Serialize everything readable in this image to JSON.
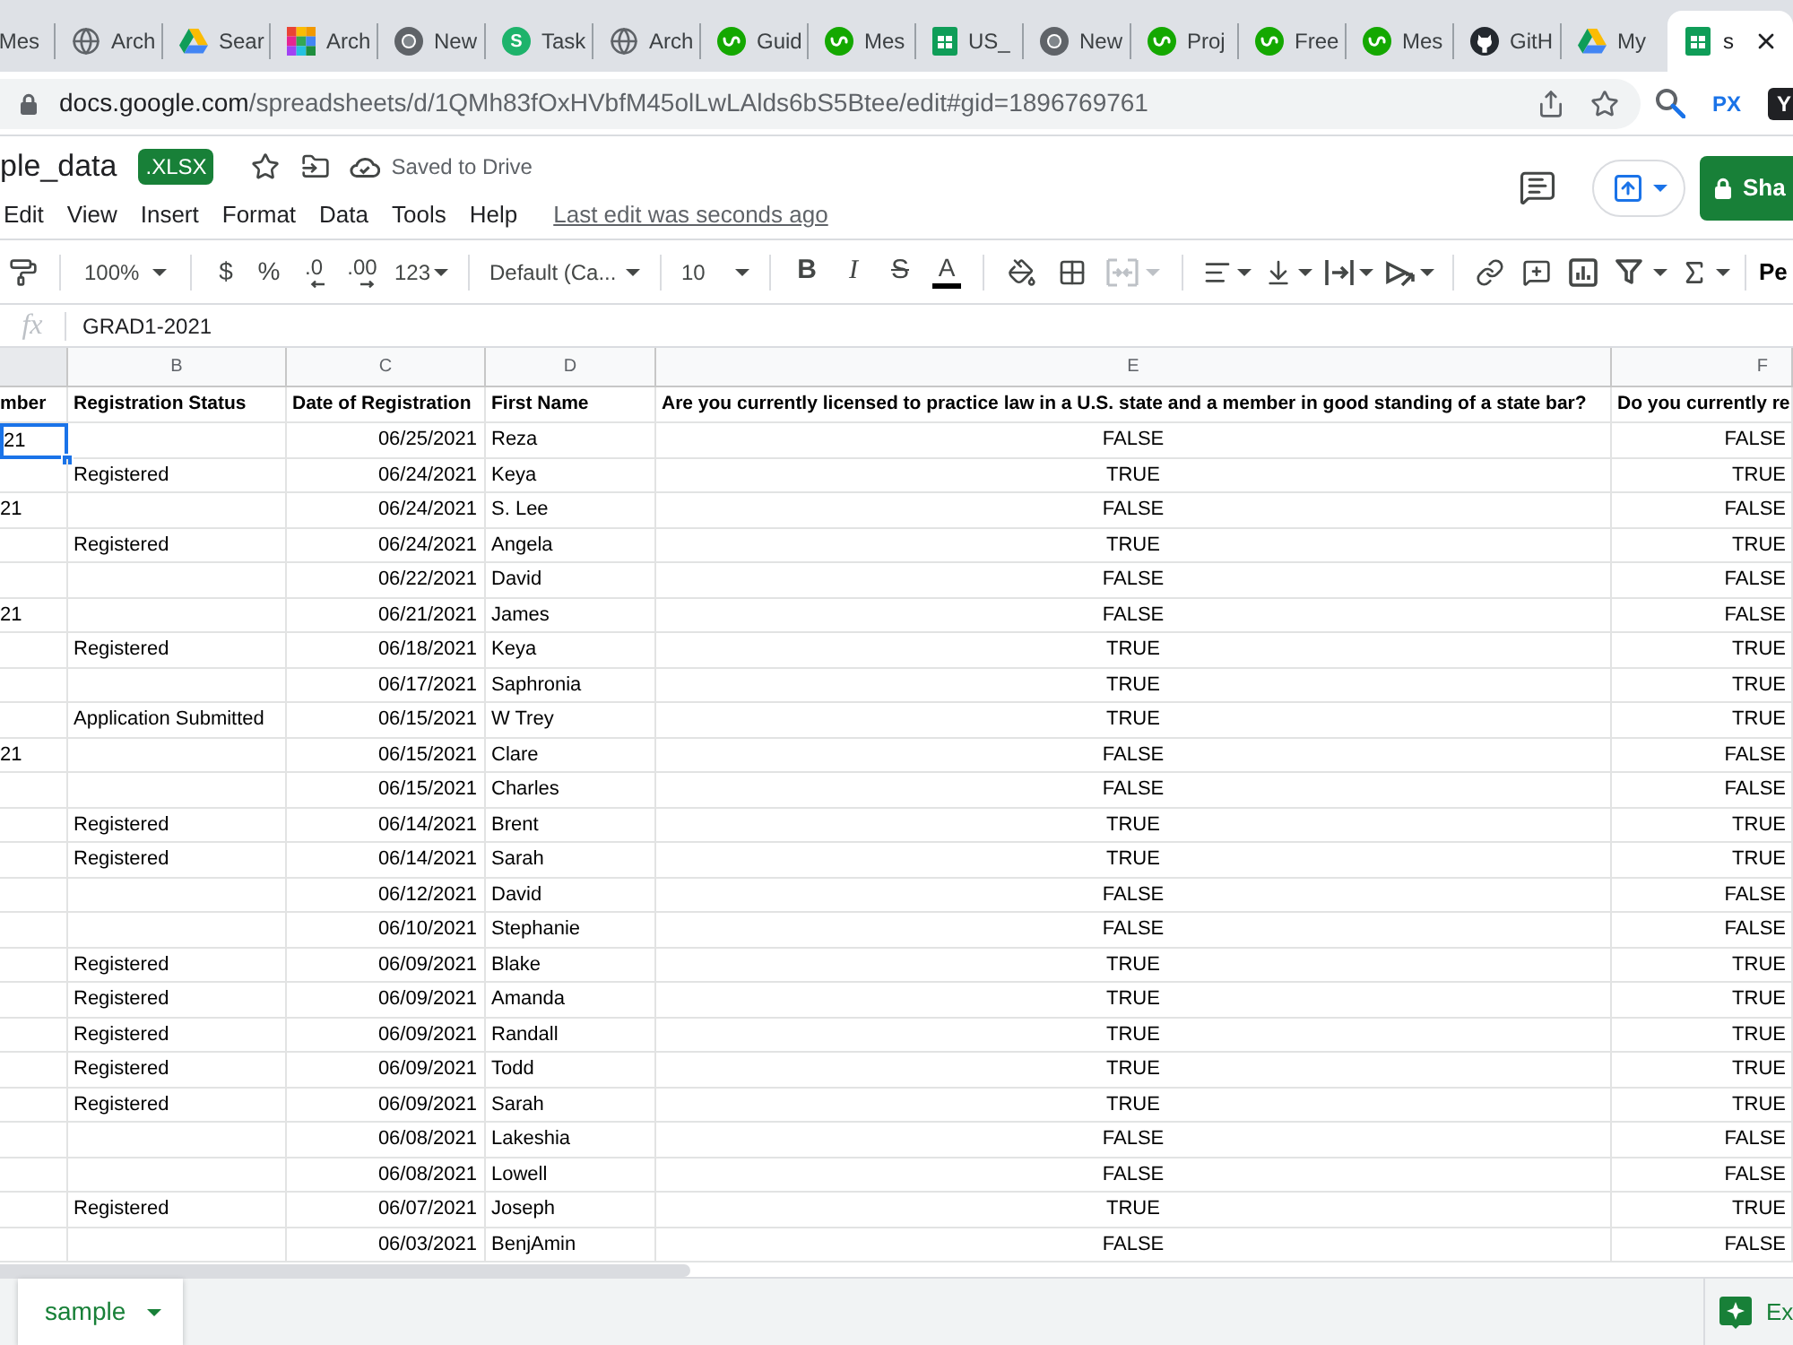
{
  "browser": {
    "tabs": [
      {
        "label": "Mes",
        "kind": "text_only",
        "selected": false
      },
      {
        "label": "Arch",
        "kind": "globe",
        "selected": false
      },
      {
        "label": "Sear",
        "kind": "drive",
        "selected": false
      },
      {
        "label": "Arch",
        "kind": "grid",
        "selected": false
      },
      {
        "label": "New",
        "kind": "chrome",
        "selected": false
      },
      {
        "label": "Task",
        "kind": "letter",
        "icon_text": "S",
        "selected": false
      },
      {
        "label": "Arch",
        "kind": "globe",
        "selected": false
      },
      {
        "label": "Guid",
        "kind": "upwork",
        "selected": false
      },
      {
        "label": "Mes",
        "kind": "upwork",
        "selected": false
      },
      {
        "label": "US_",
        "kind": "sheets",
        "selected": false
      },
      {
        "label": "New",
        "kind": "chrome",
        "selected": false
      },
      {
        "label": "Proj",
        "kind": "upwork",
        "selected": false
      },
      {
        "label": "Free",
        "kind": "upwork",
        "selected": false
      },
      {
        "label": "Mes",
        "kind": "upwork",
        "selected": false
      },
      {
        "label": "GitH",
        "kind": "github",
        "selected": false
      },
      {
        "label": "My",
        "kind": "drive",
        "selected": false
      },
      {
        "label": "s",
        "kind": "sheets",
        "selected": true
      }
    ],
    "address": {
      "host": "docs.google.com",
      "path": "/spreadsheets/d/1QMh83fOxHVbfM45olLwLAlds6bS5Btee/edit#gid=1896769761"
    },
    "extensions": [
      {
        "kind": "magnifier"
      },
      {
        "kind": "text",
        "text": "PX"
      },
      {
        "kind": "tile",
        "text": "Y"
      }
    ]
  },
  "doc": {
    "title": "ple_data",
    "badge": ".XLSX",
    "save_status": "Saved to Drive",
    "share": "Sha"
  },
  "menu": [
    "Edit",
    "View",
    "Insert",
    "Format",
    "Data",
    "Tools",
    "Help"
  ],
  "last_edit": "Last edit was seconds ago",
  "toolbar": {
    "zoom": "100%",
    "currency": "$",
    "percent": "%",
    "decimal_less": ".0",
    "decimal_more": ".00",
    "number_format": "123",
    "font": "Default (Ca...",
    "font_size": "10",
    "bold": "B",
    "italic": "I",
    "strike": "S",
    "text_color": "A",
    "merge_disabled": true,
    "overflow": "Pe"
  },
  "formula_bar": {
    "label": "fx",
    "value": "GRAD1-2021"
  },
  "columns": [
    {
      "header": "mber",
      "selected": true
    },
    {
      "letter": "B",
      "header": "Registration Status",
      "selected": false
    },
    {
      "letter": "C",
      "header": "Date of Registration",
      "selected": false
    },
    {
      "letter": "D",
      "header": "First Name",
      "selected": false
    },
    {
      "letter": "E",
      "header": "Are you currently licensed to practice law in a U.S. state and a member in good standing of a state bar?",
      "selected": false
    },
    {
      "letter": "F",
      "header": "Do you currently re",
      "selected": false
    }
  ],
  "rows": [
    {
      "cells": [
        "21",
        null,
        "06/25/2021",
        "Reza",
        "FALSE",
        "FALSE"
      ],
      "active": true
    },
    {
      "cells": [
        null,
        "Registered",
        "06/24/2021",
        "Keya",
        "TRUE",
        "TRUE"
      ],
      "active": false
    },
    {
      "cells": [
        "21",
        null,
        "06/24/2021",
        "S. Lee",
        "FALSE",
        "FALSE"
      ],
      "active": false
    },
    {
      "cells": [
        null,
        "Registered",
        "06/24/2021",
        "Angela",
        "TRUE",
        "TRUE"
      ],
      "active": false
    },
    {
      "cells": [
        null,
        null,
        "06/22/2021",
        "David",
        "FALSE",
        "FALSE"
      ],
      "active": false
    },
    {
      "cells": [
        "21",
        null,
        "06/21/2021",
        "James",
        "FALSE",
        "FALSE"
      ],
      "active": false
    },
    {
      "cells": [
        null,
        "Registered",
        "06/18/2021",
        "Keya",
        "TRUE",
        "TRUE"
      ],
      "active": false
    },
    {
      "cells": [
        null,
        null,
        "06/17/2021",
        "Saphronia",
        "TRUE",
        "TRUE"
      ],
      "active": false
    },
    {
      "cells": [
        null,
        "Application Submitted",
        "06/15/2021",
        "W Trey",
        "TRUE",
        "TRUE"
      ],
      "active": false
    },
    {
      "cells": [
        "21",
        null,
        "06/15/2021",
        "Clare",
        "FALSE",
        "FALSE"
      ],
      "active": false
    },
    {
      "cells": [
        null,
        null,
        "06/15/2021",
        "Charles",
        "FALSE",
        "FALSE"
      ],
      "active": false
    },
    {
      "cells": [
        null,
        "Registered",
        "06/14/2021",
        "Brent",
        "TRUE",
        "TRUE"
      ],
      "active": false
    },
    {
      "cells": [
        null,
        "Registered",
        "06/14/2021",
        "Sarah",
        "TRUE",
        "TRUE"
      ],
      "active": false
    },
    {
      "cells": [
        null,
        null,
        "06/12/2021",
        "David",
        "FALSE",
        "FALSE"
      ],
      "active": false
    },
    {
      "cells": [
        null,
        null,
        "06/10/2021",
        "Stephanie",
        "FALSE",
        "FALSE"
      ],
      "active": false
    },
    {
      "cells": [
        null,
        "Registered",
        "06/09/2021",
        "Blake",
        "TRUE",
        "TRUE"
      ],
      "active": false
    },
    {
      "cells": [
        null,
        "Registered",
        "06/09/2021",
        "Amanda",
        "TRUE",
        "TRUE"
      ],
      "active": false
    },
    {
      "cells": [
        null,
        "Registered",
        "06/09/2021",
        "Randall",
        "TRUE",
        "TRUE"
      ],
      "active": false
    },
    {
      "cells": [
        null,
        "Registered",
        "06/09/2021",
        "Todd",
        "TRUE",
        "TRUE"
      ],
      "active": false
    },
    {
      "cells": [
        null,
        "Registered",
        "06/09/2021",
        "Sarah",
        "TRUE",
        "TRUE"
      ],
      "active": false
    },
    {
      "cells": [
        null,
        null,
        "06/08/2021",
        "Lakeshia",
        "FALSE",
        "FALSE"
      ],
      "active": false
    },
    {
      "cells": [
        null,
        null,
        "06/08/2021",
        "Lowell",
        "FALSE",
        "FALSE"
      ],
      "active": false
    },
    {
      "cells": [
        null,
        "Registered",
        "06/07/2021",
        "Joseph",
        "TRUE",
        "TRUE"
      ],
      "active": false
    },
    {
      "cells": [
        null,
        null,
        "06/03/2021",
        "BenjAmin",
        "FALSE",
        "FALSE"
      ],
      "active": false
    }
  ],
  "sheets": [
    {
      "name": "sample",
      "selected": true
    }
  ],
  "explore": "Ex"
}
